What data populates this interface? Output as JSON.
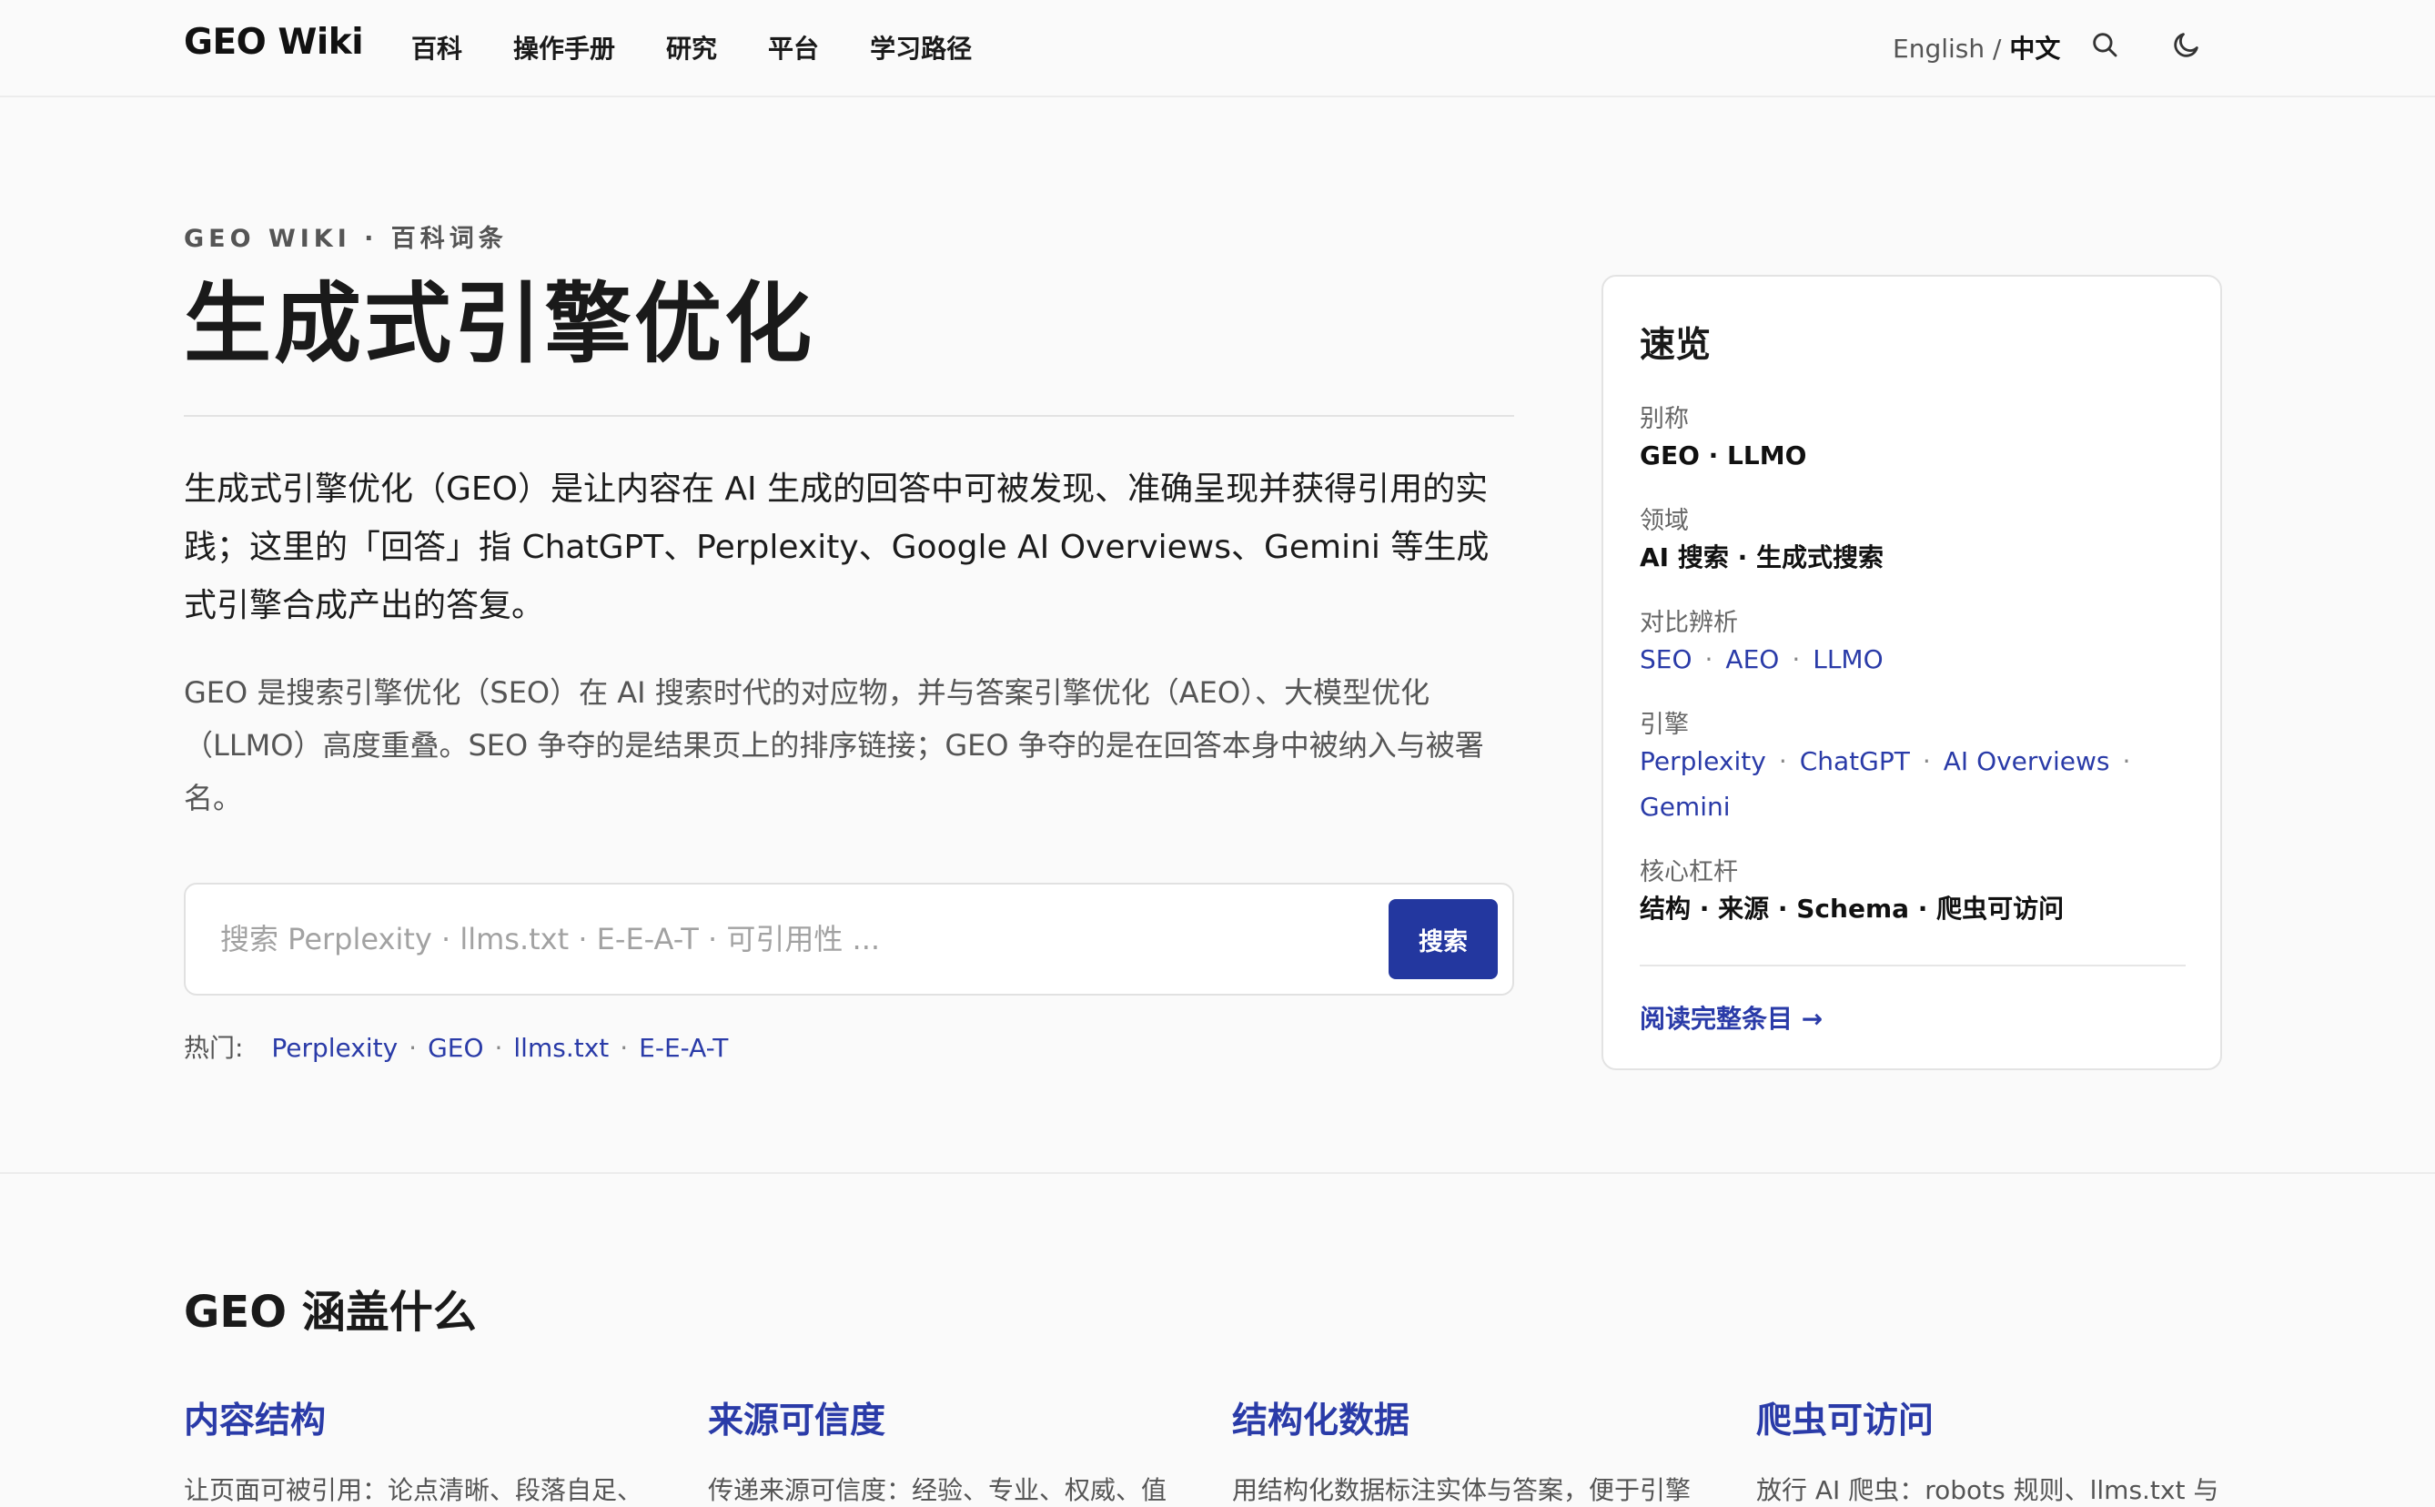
{
  "header": {
    "brand": "GEO Wiki",
    "nav": [
      "百科",
      "操作手册",
      "研究",
      "平台",
      "学习路径"
    ],
    "lang_en": "English",
    "lang_sep": " / ",
    "lang_zh": "中文",
    "icons": [
      "search-icon",
      "moon-icon"
    ]
  },
  "hero": {
    "eyebrow": "GEO WIKI · 百科词条",
    "title": "生成式引擎优化",
    "lead": "生成式引擎优化（GEO）是让内容在 AI 生成的回答中可被发现、准确呈现并获得引用的实践；这里的「回答」指 ChatGPT、Perplexity、Google AI Overviews、Gemini 等生成式引擎合成产出的答复。",
    "sub": "GEO 是搜索引擎优化（SEO）在 AI 搜索时代的对应物，并与答案引擎优化（AEO）、大模型优化（LLMO）高度重叠。SEO 争夺的是结果页上的排序链接；GEO 争夺的是在回答本身中被纳入与被署名。"
  },
  "search": {
    "placeholder": "搜索 Perplexity · llms.txt · E-E-A-T · 可引用性 ...",
    "value": "",
    "button": "搜索"
  },
  "hot": {
    "label": "热门:",
    "items": [
      "Perplexity",
      "GEO",
      "llms.txt",
      "E-E-A-T"
    ]
  },
  "card": {
    "title": "速览",
    "alias_label": "别称",
    "alias": "GEO · LLMO",
    "field_label": "领域",
    "field": "AI 搜索 · 生成式搜索",
    "compare_label": "对比辨析",
    "compare": [
      "SEO",
      "AEO",
      "LLMO"
    ],
    "engines_label": "引擎",
    "engines": [
      "Perplexity",
      "ChatGPT",
      "AI Overviews",
      "Gemini"
    ],
    "levers_label": "核心杠杆",
    "levers": "结构 · 来源 · Schema · 爬虫可访问",
    "more": "阅读完整条目 →"
  },
  "section": {
    "title": "GEO 涵盖什么",
    "features": [
      {
        "title": "内容结构",
        "desc": "让页面可被引用：论点清晰、段落自足、"
      },
      {
        "title": "来源可信度",
        "desc": "传递来源可信度：经验、专业、权威、值"
      },
      {
        "title": "结构化数据",
        "desc": "用结构化数据标注实体与答案，便于引擎"
      },
      {
        "title": "爬虫可访问",
        "desc": "放行 AI 爬虫：robots 规则、llms.txt 与"
      }
    ]
  },
  "colors": {
    "accent": "#23379f",
    "link": "#2a3ba8",
    "background": "#fafafa"
  }
}
